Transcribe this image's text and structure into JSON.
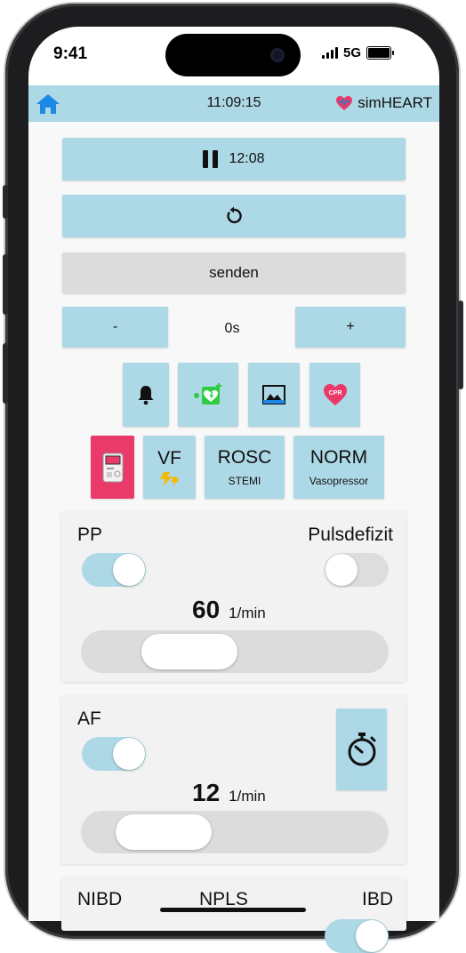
{
  "status_bar": {
    "time": "9:41",
    "network": "5G"
  },
  "header": {
    "time": "11:09:15",
    "brand": "simHEART"
  },
  "controls": {
    "timer_label": "12:08",
    "send_label": "senden",
    "minus_label": "-",
    "counter_value": "0s",
    "plus_label": "+"
  },
  "icon_buttons": [
    {
      "name": "bell-icon"
    },
    {
      "name": "defibrillator-icon"
    },
    {
      "name": "image-icon"
    },
    {
      "name": "cpr-heart-icon",
      "text": "CPR"
    }
  ],
  "rhythm_buttons": [
    {
      "top": "VF",
      "bottom_icon": "lightning-icon"
    },
    {
      "top": "ROSC",
      "bottom": "STEMI"
    },
    {
      "top": "NORM",
      "bottom": "Vasopressor"
    }
  ],
  "pp_panel": {
    "left_label": "PP",
    "right_label": "Pulsdefizit",
    "pp_on": true,
    "pulsdefizit_on": false,
    "value": "60",
    "unit": "1/min",
    "slider_level_percent": 28
  },
  "af_panel": {
    "label": "AF",
    "af_on": true,
    "value": "12",
    "unit": "1/min",
    "slider_level_percent": 15
  },
  "bottom_panel": {
    "labels": [
      "NIBD",
      "NPLS",
      "IBD"
    ]
  },
  "colors": {
    "accent": "#add8e6",
    "danger": "#e93a6a",
    "gray": "#dcdcdc"
  }
}
